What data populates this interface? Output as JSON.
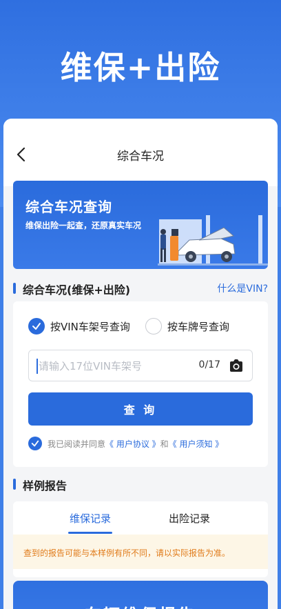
{
  "promo": {
    "title": "维保+出险"
  },
  "nav": {
    "title": "综合车况"
  },
  "banner": {
    "title": "综合车况查询",
    "subtitle": "维保出险一起查，还原真实车况"
  },
  "query_section": {
    "title": "综合车况(维保+出险)",
    "vin_help_link": "什么是VIN?"
  },
  "form": {
    "options": [
      {
        "label": "按VIN车架号查询",
        "selected": true
      },
      {
        "label": "按车牌号查询",
        "selected": false
      }
    ],
    "vin_input": {
      "value": "",
      "placeholder": "请输入17位VIN车架号",
      "counter": "0/17"
    },
    "submit_label": "查 询",
    "agreement": {
      "prefix": "我已阅读并同意",
      "link1": "《 用户协议 》",
      "conj": "和",
      "link2": "《 用户须知 》",
      "checked": true
    }
  },
  "sample_section": {
    "title": "样例报告"
  },
  "sample_tabs": {
    "tabs": [
      {
        "label": "维保记录",
        "active": true
      },
      {
        "label": "出险记录",
        "active": false
      }
    ],
    "notice": "查到的报告可能与本样例有所不同，请以实际报告为准。"
  },
  "bottom_card": {
    "title": "车辆维保报告"
  },
  "colors": {
    "primary": "#2a6bdc",
    "notice_bg": "#fdf6e6",
    "notice_text": "#e07b1a"
  }
}
